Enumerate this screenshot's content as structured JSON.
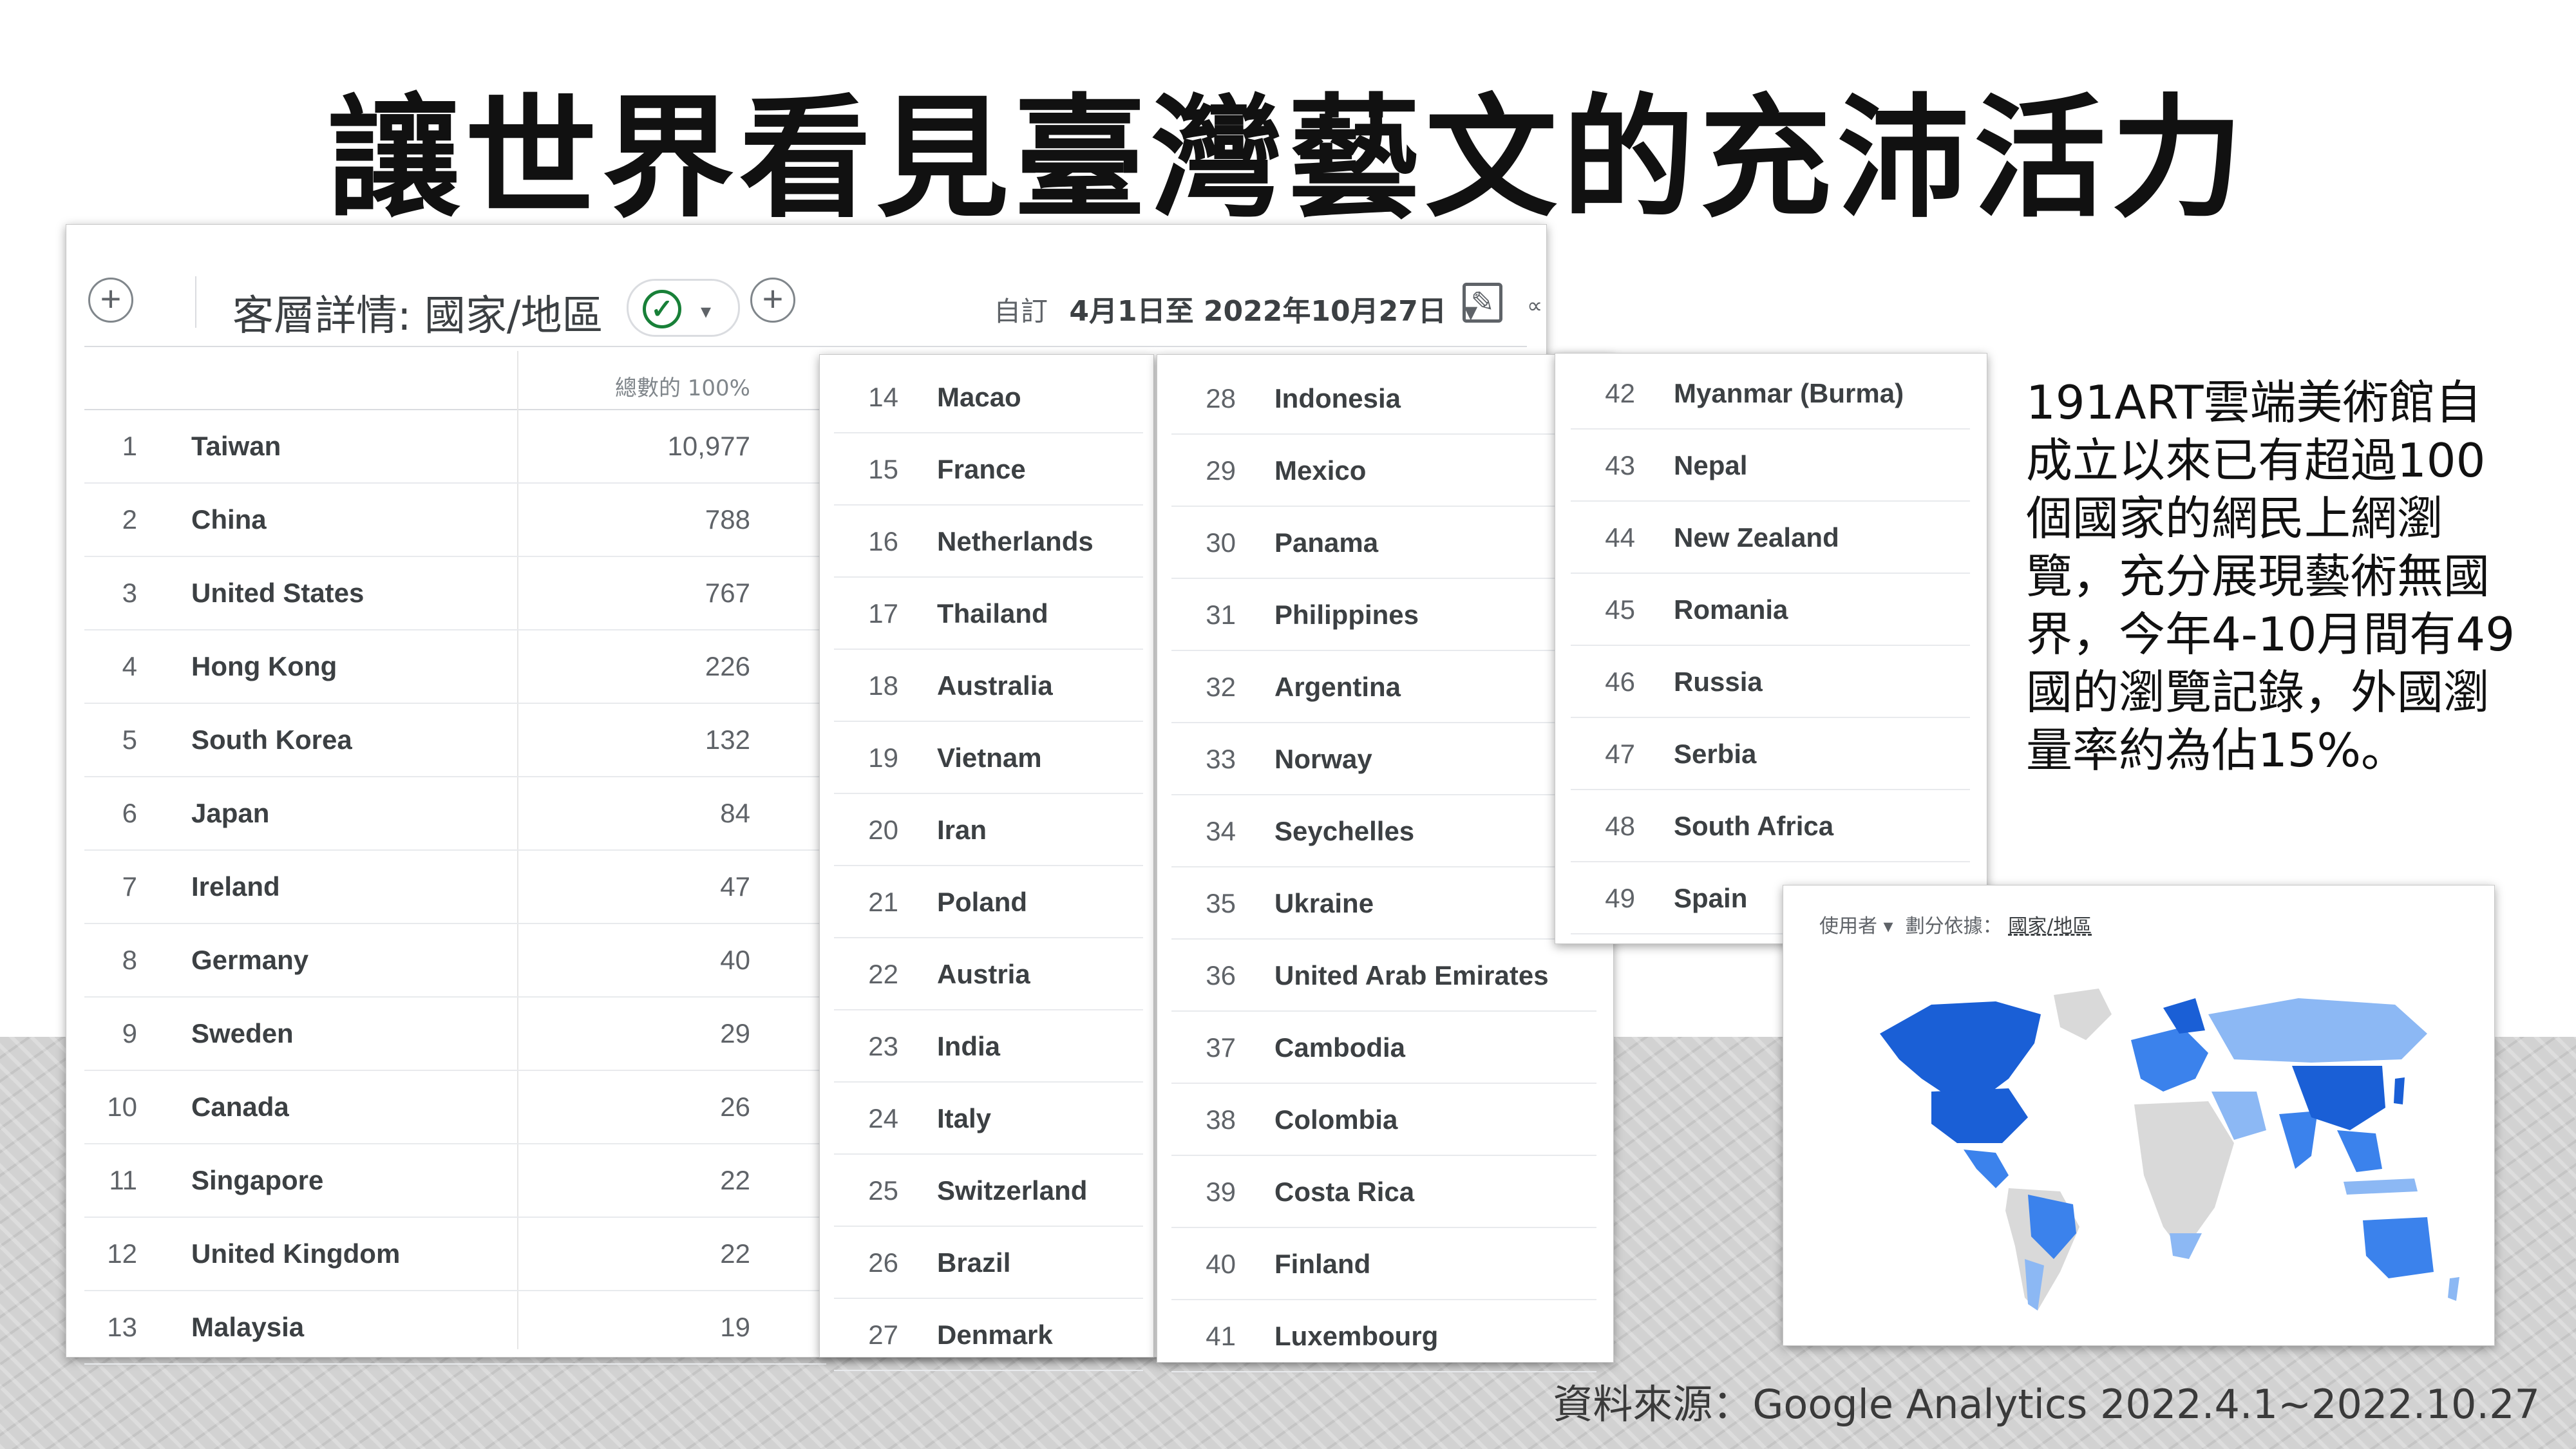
{
  "slide": {
    "title": "讓世界看見臺灣藝文的充沛活力",
    "description": "191ART雲端美術館自成立以來已有超過100個國家的網民上網瀏覽，充分展現藝術無國界，今年4-10月間有49國的瀏覽記錄，外國瀏量率約為佔15%。",
    "source": "資料來源：Google Analytics 2022.4.1~2022.10.27"
  },
  "toolbar": {
    "add_label": "+",
    "title": "客層詳情: 國家/地區",
    "add_compare_label": "+",
    "date_mode": "自訂",
    "date_range": "4月1日至 2022年10月27日",
    "dropdown_caret": "▾"
  },
  "table": {
    "total_header": "總數的 100%",
    "rows": [
      {
        "idx": "1",
        "country": "Taiwan",
        "value": "10,977"
      },
      {
        "idx": "2",
        "country": "China",
        "value": "788"
      },
      {
        "idx": "3",
        "country": "United States",
        "value": "767"
      },
      {
        "idx": "4",
        "country": "Hong Kong",
        "value": "226"
      },
      {
        "idx": "5",
        "country": "South Korea",
        "value": "132"
      },
      {
        "idx": "6",
        "country": "Japan",
        "value": "84"
      },
      {
        "idx": "7",
        "country": "Ireland",
        "value": "47"
      },
      {
        "idx": "8",
        "country": "Germany",
        "value": "40"
      },
      {
        "idx": "9",
        "country": "Sweden",
        "value": "29"
      },
      {
        "idx": "10",
        "country": "Canada",
        "value": "26"
      },
      {
        "idx": "11",
        "country": "Singapore",
        "value": "22"
      },
      {
        "idx": "12",
        "country": "United Kingdom",
        "value": "22"
      },
      {
        "idx": "13",
        "country": "Malaysia",
        "value": "19"
      }
    ]
  },
  "columns": [
    [
      "14",
      "Macao"
    ],
    [
      "15",
      "France"
    ],
    [
      "16",
      "Netherlands"
    ],
    [
      "17",
      "Thailand"
    ],
    [
      "18",
      "Australia"
    ],
    [
      "19",
      "Vietnam"
    ],
    [
      "20",
      "Iran"
    ],
    [
      "21",
      "Poland"
    ],
    [
      "22",
      "Austria"
    ],
    [
      "23",
      "India"
    ],
    [
      "24",
      "Italy"
    ],
    [
      "25",
      "Switzerland"
    ],
    [
      "26",
      "Brazil"
    ],
    [
      "27",
      "Denmark"
    ]
  ],
  "columns2": [
    [
      "28",
      "Indonesia"
    ],
    [
      "29",
      "Mexico"
    ],
    [
      "30",
      "Panama"
    ],
    [
      "31",
      "Philippines"
    ],
    [
      "32",
      "Argentina"
    ],
    [
      "33",
      "Norway"
    ],
    [
      "34",
      "Seychelles"
    ],
    [
      "35",
      "Ukraine"
    ],
    [
      "36",
      "United Arab Emirates"
    ],
    [
      "37",
      "Cambodia"
    ],
    [
      "38",
      "Colombia"
    ],
    [
      "39",
      "Costa Rica"
    ],
    [
      "40",
      "Finland"
    ],
    [
      "41",
      "Luxembourg"
    ]
  ],
  "columns3": [
    [
      "42",
      "Myanmar (Burma)"
    ],
    [
      "43",
      "Nepal"
    ],
    [
      "44",
      "New Zealand"
    ],
    [
      "45",
      "Romania"
    ],
    [
      "46",
      "Russia"
    ],
    [
      "47",
      "Serbia"
    ],
    [
      "48",
      "South Africa"
    ],
    [
      "49",
      "Spain"
    ]
  ],
  "map": {
    "metric": "使用者 ▾",
    "split_label": "劃分依據：",
    "split_value": "國家/地區",
    "colors": {
      "dark": "#1a5fd6",
      "mid": "#3b82ec",
      "light": "#8cb8f4",
      "none": "#d9d9d9"
    }
  }
}
